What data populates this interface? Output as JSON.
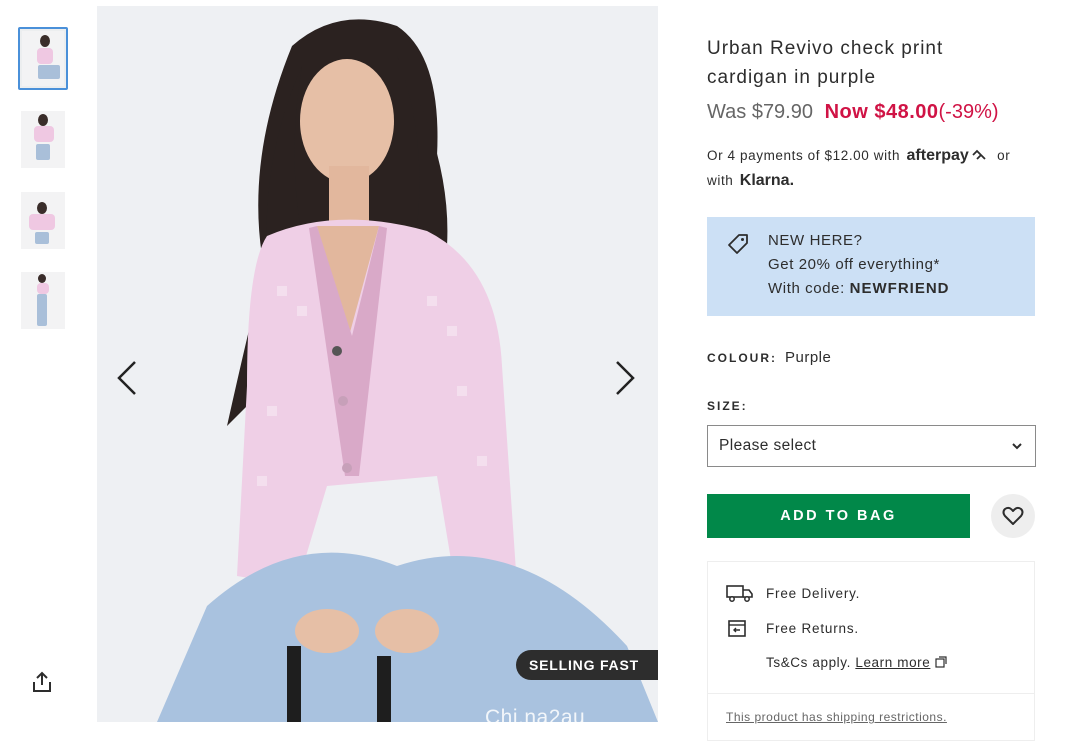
{
  "gallery": {
    "thumbnails": [
      "thumb-1",
      "thumb-2",
      "thumb-3",
      "thumb-4"
    ],
    "selected_index": 0,
    "badge": "SELLING FAST",
    "watermark": "Chi.na2au"
  },
  "product": {
    "title": "Urban Revivo check print cardigan in purple",
    "was_price": "Was $79.90",
    "now_price": "Now $48.00",
    "discount": "(-39%)"
  },
  "payments": {
    "prefix": "Or 4 payments of $12.00 with",
    "afterpay": "afterpay",
    "or": "or",
    "with": "with",
    "klarna": "Klarna."
  },
  "promo": {
    "line1": "NEW HERE?",
    "line2": "Get 20% off everything*",
    "code_prefix": "With code:",
    "code": "NEWFRIEND"
  },
  "colour": {
    "label": "COLOUR:",
    "value": "Purple"
  },
  "size": {
    "label": "SIZE:",
    "selected": "Please select"
  },
  "actions": {
    "add_to_bag": "ADD TO BAG"
  },
  "delivery": {
    "free_delivery": "Free Delivery.",
    "free_returns": "Free Returns.",
    "tcs": "Ts&Cs apply.",
    "learn_more": "Learn more",
    "restriction": "This product has shipping restrictions."
  },
  "colors": {
    "sale_red": "#d01345",
    "add_green": "#018849",
    "promo_blue": "#cce0f5"
  }
}
